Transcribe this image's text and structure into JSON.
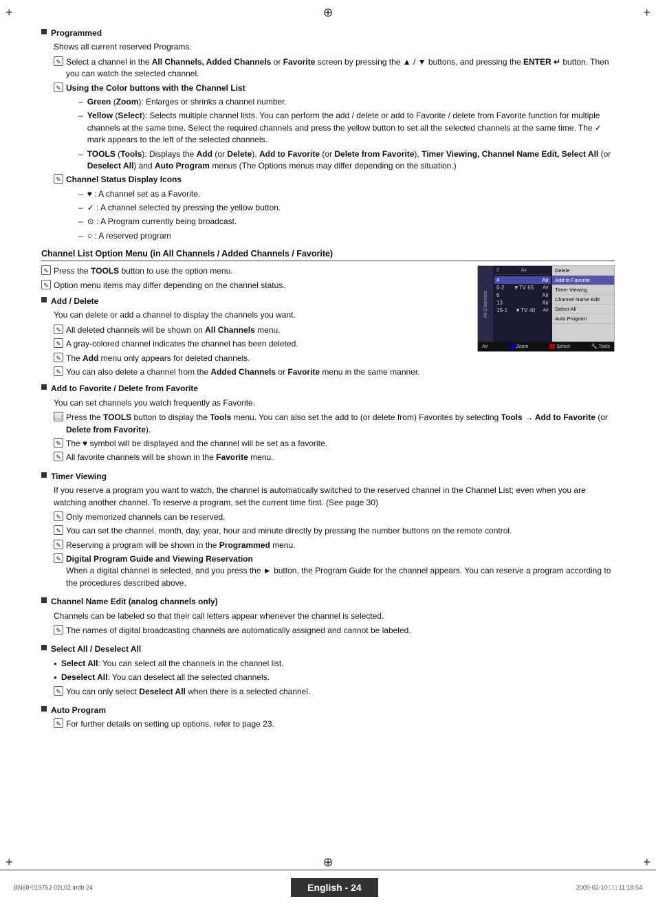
{
  "page": {
    "corners": {
      "tl": "+",
      "tr": "+",
      "bl": "+",
      "br": "+"
    },
    "center_top": "⊕",
    "center_bottom": "⊕"
  },
  "sections": {
    "programmed_title": "Programmed",
    "programmed_desc": "Shows all current reserved Programs.",
    "note1": "Select a channel in the All Channels, Added Channels or Favorite screen by pressing the ▲ / ▼ buttons, and pressing the ENTER  button. Then you can watch the selected channel.",
    "note1_bold_parts": [
      "All Channels, Added Channels",
      "Favorite",
      "ENTER"
    ],
    "note2_title": "Using the Color buttons with the Channel List",
    "dash_green": "Green (Zoom): Enlarges or shrinks a channel number.",
    "dash_green_bold": [
      "Green",
      "Zoom"
    ],
    "dash_yellow": "Yellow (Select): Selects multiple channel lists. You can perform the add / delete or add to Favorite / delete from Favorite function for multiple channels at the same time. Select the required channels and press the yellow button to set all the selected channels at the same time. The  ✓  mark appears to the left of the selected channels.",
    "dash_yellow_bold": [
      "Yellow",
      "Select"
    ],
    "dash_tools": "TOOLS (Tools): Displays the Add (or Delete), Add to Favorite (or Delete from Favorite), Timer Viewing, Channel Name Edit, Select All (or Deselect All) and Auto Program menus (The Options menus may differ depending on the situation.)",
    "dash_tools_bold": [
      "TOOLS",
      "Tools",
      "Add",
      "Delete",
      "Add to Favorite",
      "Delete from Favorite",
      "Timer Viewing, Channel Name Edit, Select All",
      "Deselect All",
      "Auto Program"
    ],
    "note3_title": "Channel Status Display Icons",
    "dash_heart": "♥ : A channel set as a Favorite.",
    "dash_check": "✓ : A channel selected by pressing the yellow button.",
    "dash_broadcast": " : A Program currently being broadcast.",
    "dash_reserved": " : A reserved program",
    "channel_list_section_title": "Channel List Option Menu (in All Channels / Added Channels / Favorite)",
    "channel_note1": "Press the TOOLS button to use the option menu.",
    "channel_note1_bold": [
      "TOOLS"
    ],
    "channel_note2": "Option menu items may differ depending on the channel status.",
    "add_delete_title": "Add / Delete",
    "add_delete_desc": "You can delete or add a channel to display the channels you want.",
    "add_delete_n1": "All deleted channels will be shown on All Channels menu.",
    "add_delete_n1_bold": [
      "All Channels"
    ],
    "add_delete_n2": "A gray-colored channel indicates the channel has been deleted.",
    "add_delete_n3": "The Add menu only appears for deleted channels.",
    "add_delete_n3_bold": [
      "Add"
    ],
    "add_delete_n4": "You can also delete a channel from the Added Channels or Favorite menu in the same manner.",
    "add_delete_n4_bold": [
      "Added Channels",
      "Favorite"
    ],
    "add_fav_title": "Add to Favorite / Delete from Favorite",
    "add_fav_desc": "You can set channels you watch frequently as Favorite.",
    "add_fav_n1": "Press the TOOLS button to display the Tools menu. You can also set the add to (or delete from) Favorites by selecting Tools → Add to Favorite (or Delete from Favorite).",
    "add_fav_n1_bold": [
      "TOOLS",
      "Tools",
      "Tools",
      "Add to Favorite",
      "Delete from Favorite"
    ],
    "add_fav_n2": "The ♥ symbol will be displayed and the channel will be set as a favorite.",
    "add_fav_n2_bold": [
      "♥"
    ],
    "add_fav_n3": "All favorite channels will be shown in the Favorite menu.",
    "add_fav_n3_bold": [
      "Favorite"
    ],
    "timer_title": "Timer Viewing",
    "timer_desc": "If you reserve a program you want to watch, the channel is automatically switched to the reserved channel in the Channel List; even when you are watching another channel. To reserve a program, set the current time first. (See page 30)",
    "timer_n1": "Only memorized channels can be reserved.",
    "timer_n2": "You can set the channel, month, day, year, hour and minute directly by pressing the number buttons on the remote control.",
    "timer_n3": "Reserving a program will be shown in the Programmed menu.",
    "timer_n3_bold": [
      "Programmed"
    ],
    "timer_n4_title": "Digital Program Guide and Viewing Reservation",
    "timer_n4_desc": "When a digital channel is selected, and you press the ► button, the Program Guide for the channel appears. You can reserve a program according to the procedures described above.",
    "timer_n4_bold": [
      "►"
    ],
    "channel_name_title": "Channel Name Edit (analog channels only)",
    "channel_name_desc": "Channels can be labeled so that their call letters appear whenever the channel is selected.",
    "channel_name_n1": "The names of digital broadcasting channels are automatically assigned and cannot be labeled.",
    "select_all_title": "Select All / Deselect All",
    "select_all_dot1": "Select All: You can select all the channels in the channel list.",
    "select_all_dot1_bold": [
      "Select All"
    ],
    "select_all_dot2": "Deselect All: You can deselect all the selected channels.",
    "select_all_dot2_bold": [
      "Deselect All"
    ],
    "select_all_n1": "You can only select Deselect All when there is a selected channel.",
    "select_all_n1_bold": [
      "Deselect All"
    ],
    "auto_program_title": "Auto Program",
    "auto_program_n1": "For further details on setting up options, refer to page 23."
  },
  "tv_mockup": {
    "tab_label": "All Channels",
    "header_ch": "2",
    "header_air": "Air",
    "channels": [
      {
        "num": "4",
        "type": "Air",
        "extra": "",
        "selected": true
      },
      {
        "num": "6-2",
        "type": "▼TV 65",
        "extra": "Air",
        "selected": false
      },
      {
        "num": "6",
        "type": "Air",
        "extra": "",
        "selected": false
      },
      {
        "num": "13",
        "type": "Air",
        "extra": "",
        "selected": false
      },
      {
        "num": "15-1",
        "type": "▼TV 40",
        "extra": "Air",
        "selected": false
      }
    ],
    "menu_title": "",
    "menu_items": [
      {
        "label": "Delete",
        "highlight": false
      },
      {
        "label": "Add to Favorite",
        "highlight": true
      },
      {
        "label": "Timer Viewing",
        "highlight": false
      },
      {
        "label": "Channel Name Edit",
        "highlight": false
      },
      {
        "label": "Select All",
        "highlight": false
      },
      {
        "label": "Auto Program",
        "highlight": false
      }
    ],
    "footer": {
      "air": "Air",
      "zoom": "Zoom",
      "select": "Select",
      "tools": "Tools"
    }
  },
  "bottom": {
    "left_text": "BN68-01975J-02L02.indb   24",
    "center_text": "English - 24",
    "right_text": "2009-02-10   □□ 11:18:54"
  }
}
